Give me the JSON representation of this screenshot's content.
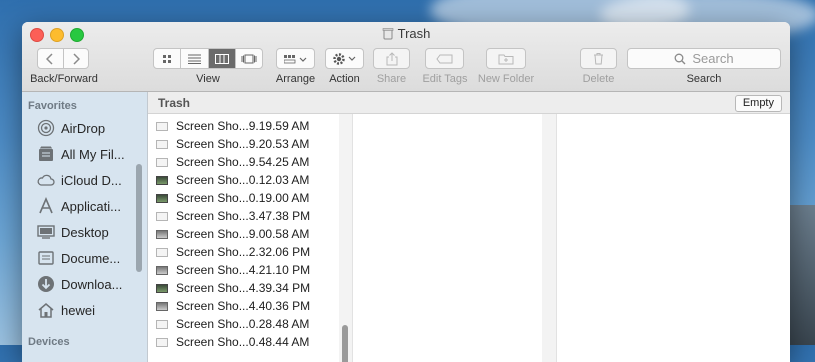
{
  "window": {
    "title": "Trash"
  },
  "toolbar": {
    "back_forward_label": "Back/Forward",
    "view_label": "View",
    "arrange_label": "Arrange",
    "action_label": "Action",
    "share_label": "Share",
    "edit_tags_label": "Edit Tags",
    "new_folder_label": "New Folder",
    "delete_label": "Delete",
    "search_label": "Search",
    "search_placeholder": "Search",
    "active_view": "columns"
  },
  "sidebar": {
    "favorites_header": "Favorites",
    "devices_header": "Devices",
    "items": [
      {
        "label": "AirDrop",
        "icon": "airdrop-icon"
      },
      {
        "label": "All My Fil...",
        "icon": "all-files-icon"
      },
      {
        "label": "iCloud D...",
        "icon": "icloud-icon"
      },
      {
        "label": "Applicati...",
        "icon": "applications-icon"
      },
      {
        "label": "Desktop",
        "icon": "desktop-icon"
      },
      {
        "label": "Docume...",
        "icon": "documents-icon"
      },
      {
        "label": "Downloa...",
        "icon": "downloads-icon"
      },
      {
        "label": "hewei",
        "icon": "home-icon"
      }
    ]
  },
  "pathbar": {
    "title": "Trash",
    "empty_label": "Empty"
  },
  "files": [
    {
      "name": "Screen Sho...9.19.59 AM",
      "thumb": "light"
    },
    {
      "name": "Screen Sho...9.20.53 AM",
      "thumb": "light"
    },
    {
      "name": "Screen Sho...9.54.25 AM",
      "thumb": "light"
    },
    {
      "name": "Screen Sho...0.12.03 AM",
      "thumb": "dark"
    },
    {
      "name": "Screen Sho...0.19.00 AM",
      "thumb": "dark"
    },
    {
      "name": "Screen Sho...3.47.38 PM",
      "thumb": "light"
    },
    {
      "name": "Screen Sho...9.00.58 AM",
      "thumb": "mid"
    },
    {
      "name": "Screen Sho...2.32.06 PM",
      "thumb": "light"
    },
    {
      "name": "Screen Sho...4.21.10 PM",
      "thumb": "mid"
    },
    {
      "name": "Screen Sho...4.39.34 PM",
      "thumb": "dark"
    },
    {
      "name": "Screen Sho...4.40.36 PM",
      "thumb": "mid"
    },
    {
      "name": "Screen Sho...0.28.48 AM",
      "thumb": "light"
    },
    {
      "name": "Screen Sho...0.48.44 AM",
      "thumb": "light"
    }
  ]
}
